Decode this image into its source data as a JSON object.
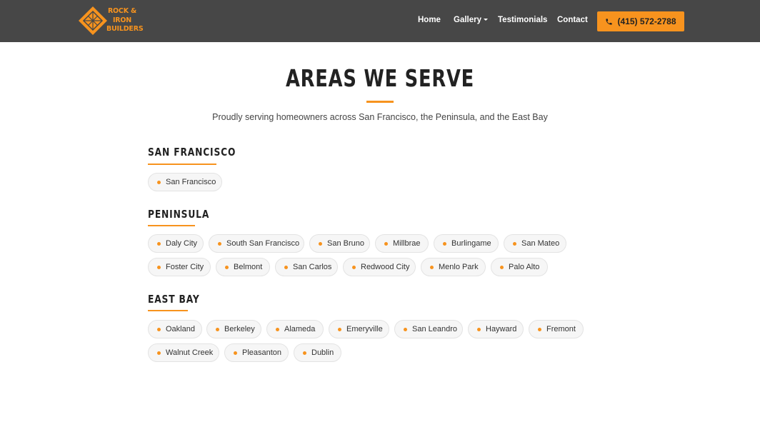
{
  "brand": {
    "logo_text": "ROCK & IRON BUILDERS",
    "accent_color": "#f7931e",
    "nav_bg": "#474747"
  },
  "nav": {
    "links": [
      "Home",
      "Gallery",
      "Testimonials",
      "Contact"
    ],
    "gallery_has_dropdown": true,
    "phone": "(415) 572-2788",
    "phone_icon": "phone-icon"
  },
  "main": {
    "title": "AREAS WE SERVE",
    "subtitle": "Proudly serving homeowners across San Francisco, the Peninsula, and the East Bay"
  },
  "regions": [
    {
      "name": "SAN FRANCISCO",
      "cities": [
        "San Francisco"
      ]
    },
    {
      "name": "PENINSULA",
      "cities": [
        "Daly City",
        "South San Francisco",
        "San Bruno",
        "Millbrae",
        "Burlingame",
        "San Mateo",
        "Foster City",
        "Belmont",
        "San Carlos",
        "Redwood City",
        "Menlo Park",
        "Palo Alto"
      ]
    },
    {
      "name": "EAST BAY",
      "cities": [
        "Oakland",
        "Berkeley",
        "Alameda",
        "Emeryville",
        "San Leandro",
        "Hayward",
        "Fremont",
        "Walnut Creek",
        "Pleasanton",
        "Dublin"
      ]
    }
  ]
}
